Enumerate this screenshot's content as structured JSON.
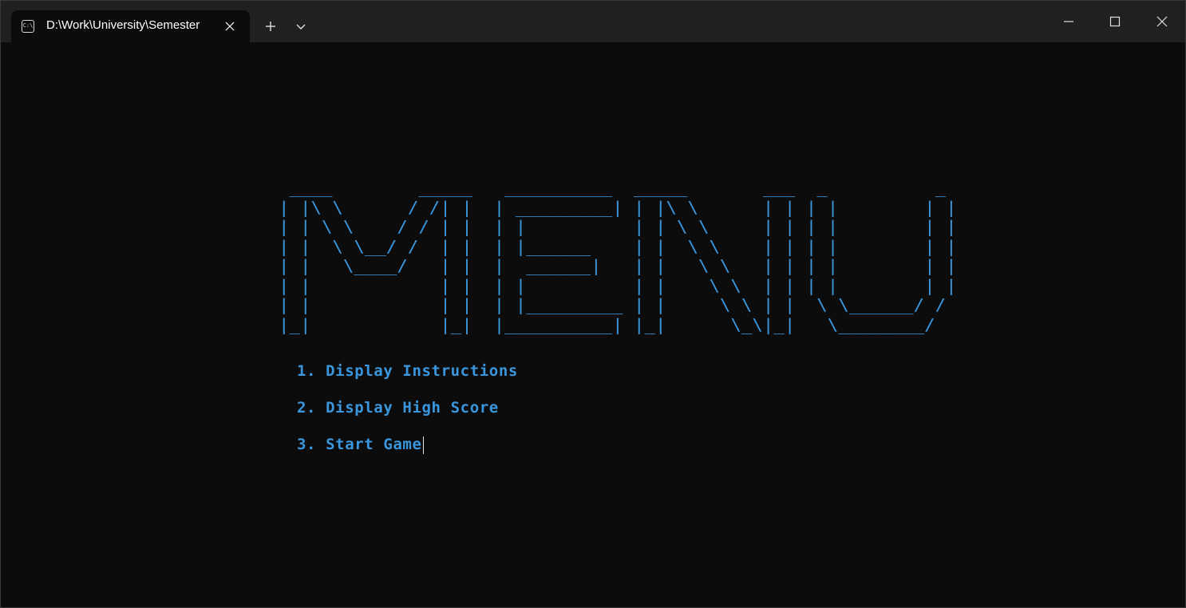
{
  "window": {
    "tab_title": "D:\\Work\\University\\Semester",
    "tab_icon": "terminal-icon",
    "tab_icon_glyph": "C:\\",
    "buttons": {
      "close_tab": "close-icon",
      "new_tab": "plus-icon",
      "dropdown": "chevron-down-icon",
      "minimize": "minimize-icon",
      "maximize": "maximize-icon",
      "close": "close-icon"
    }
  },
  "terminal": {
    "ascii_title": " ____        _____   __________  _____       ___  _          _\n| |\\ \\      / /| |  | _________| | |\\ \\      | | | |        | |\n| | \\ \\    / / | |  | |          | | \\ \\     | | | |        | |\n| |  \\ \\__/ /  | |  | |______    | |  \\ \\    | | | |        | |\n| |   \\____/   | |  |  ______|   | |   \\ \\   | | | |        | |\n| |            | |  | |          | |    \\ \\  | | | |        | |\n| |            | |  | |_________ | |     \\ \\ | |  \\ \\______/ /\n|_|            |_|  |__________| |_|      \\_\\|_|   \\________/",
    "menu": [
      "1. Display Instructions",
      "2. Display High Score",
      "3. Start Game"
    ],
    "colors": {
      "background": "#0c0c0c",
      "text": "#3a96dd",
      "titlebar": "#202020"
    }
  }
}
